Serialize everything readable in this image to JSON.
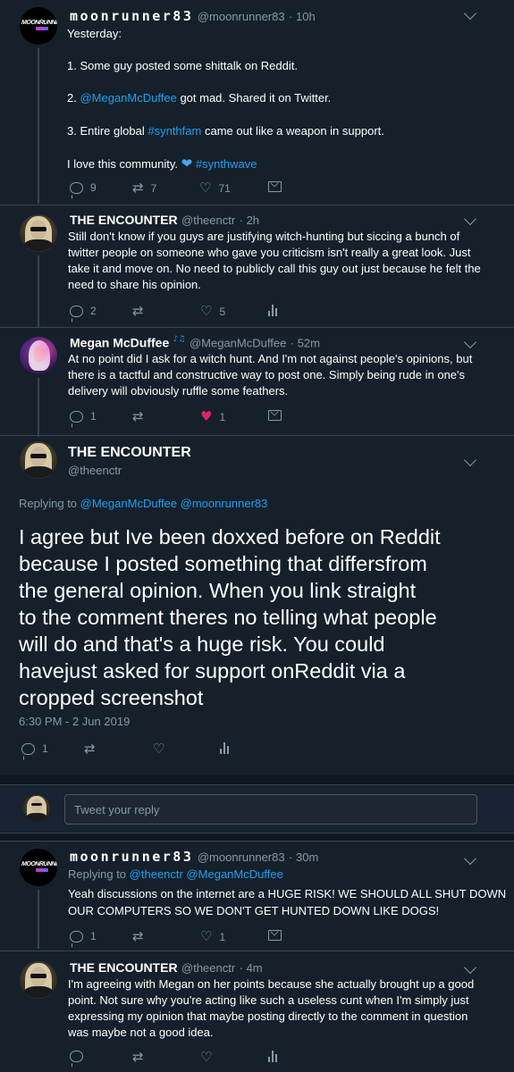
{
  "tweets": [
    {
      "name": "moonrunner83",
      "handle": "@moonrunner83",
      "time": "· 10h",
      "lines": [
        "Yesterday:",
        "1. Some guy posted some shittalk on Reddit.",
        "got mad. Shared it on Twitter.",
        "came out like a weapon in support.",
        "I love this community."
      ],
      "mention": "@MeganMcDuffee",
      "item2_prefix": "2.",
      "item3_prefix": "3. Entire global",
      "hashtag1": "#synthfam",
      "hashtag2": "#synthwave",
      "replies": "9",
      "retweets": "7",
      "likes": "71"
    },
    {
      "name": "THE ENCOUNTER",
      "handle": "@theenctr",
      "time": "· 2h",
      "lines": [
        "Still don't know if you guys are justifying witch-hunting but siccing a bunch of",
        "twitter people on someone who gave you criticism isn't really a great look. Just",
        "take it and move on. No need to publicly call this guy out just because he felt the",
        "need to share his opinion."
      ],
      "replies": "2",
      "retweets": "",
      "likes": "5"
    },
    {
      "name": "Megan McDuffee",
      "handle": "@MeganMcDuffee",
      "time": "· 52m",
      "lines": [
        "At no point did I ask for a witch hunt. And I'm not against people's opinions, but",
        "there is a tactful and constructive way to post one. Simply being rude in one's",
        "delivery will obviously ruffle some feathers."
      ],
      "replies": "1",
      "retweets": "",
      "likes": "1"
    }
  ],
  "main_tweet": {
    "name": "THE ENCOUNTER",
    "handle": "@theenctr",
    "replying_prefix": "Replying to",
    "replying_to": "@MeganMcDuffee @moonrunner83",
    "lines": [
      "I agree but Ive been doxxed before on Reddit",
      "because I posted something that differsfrom",
      "the general opinion. When you link straight",
      "to the comment theres no telling what people",
      "will do and that's a huge risk. You could",
      "havejust asked for support onReddit via a",
      "cropped screenshot"
    ],
    "timestamp": "6:30 PM - 2 Jun 2019",
    "replies": "1"
  },
  "reply_box": {
    "placeholder": "Tweet your reply"
  },
  "replies": [
    {
      "name": "moonrunner83",
      "handle": "@moonrunner83",
      "time": "· 30m",
      "replying_prefix": "Replying to",
      "replying_to": "@theenctr @MeganMcDuffee",
      "lines": [
        "Yeah discussions on the internet are a HUGE RISK! WE SHOULD ALL SHUT DOWN",
        "OUR COMPUTERS SO WE DON'T GET HUNTED DOWN LIKE DOGS!"
      ],
      "replies": "1",
      "likes": "1"
    },
    {
      "name": "THE ENCOUNTER",
      "handle": "@theenctr",
      "time": "· 4m",
      "lines": [
        "I'm agreeing with Megan on her points because she actually brought up a good",
        "point. Not sure why you're acting like such a useless cunt when I'm simply just",
        "expressing my opinion that maybe posting directly to the comment in question",
        "was maybe not a good idea."
      ]
    }
  ],
  "avatar_logo_text": "MOONRUNNER",
  "colors": {
    "background": "#15202b",
    "link": "#1da1f2",
    "like_active": "#e0245e",
    "muted": "#8899a6"
  }
}
